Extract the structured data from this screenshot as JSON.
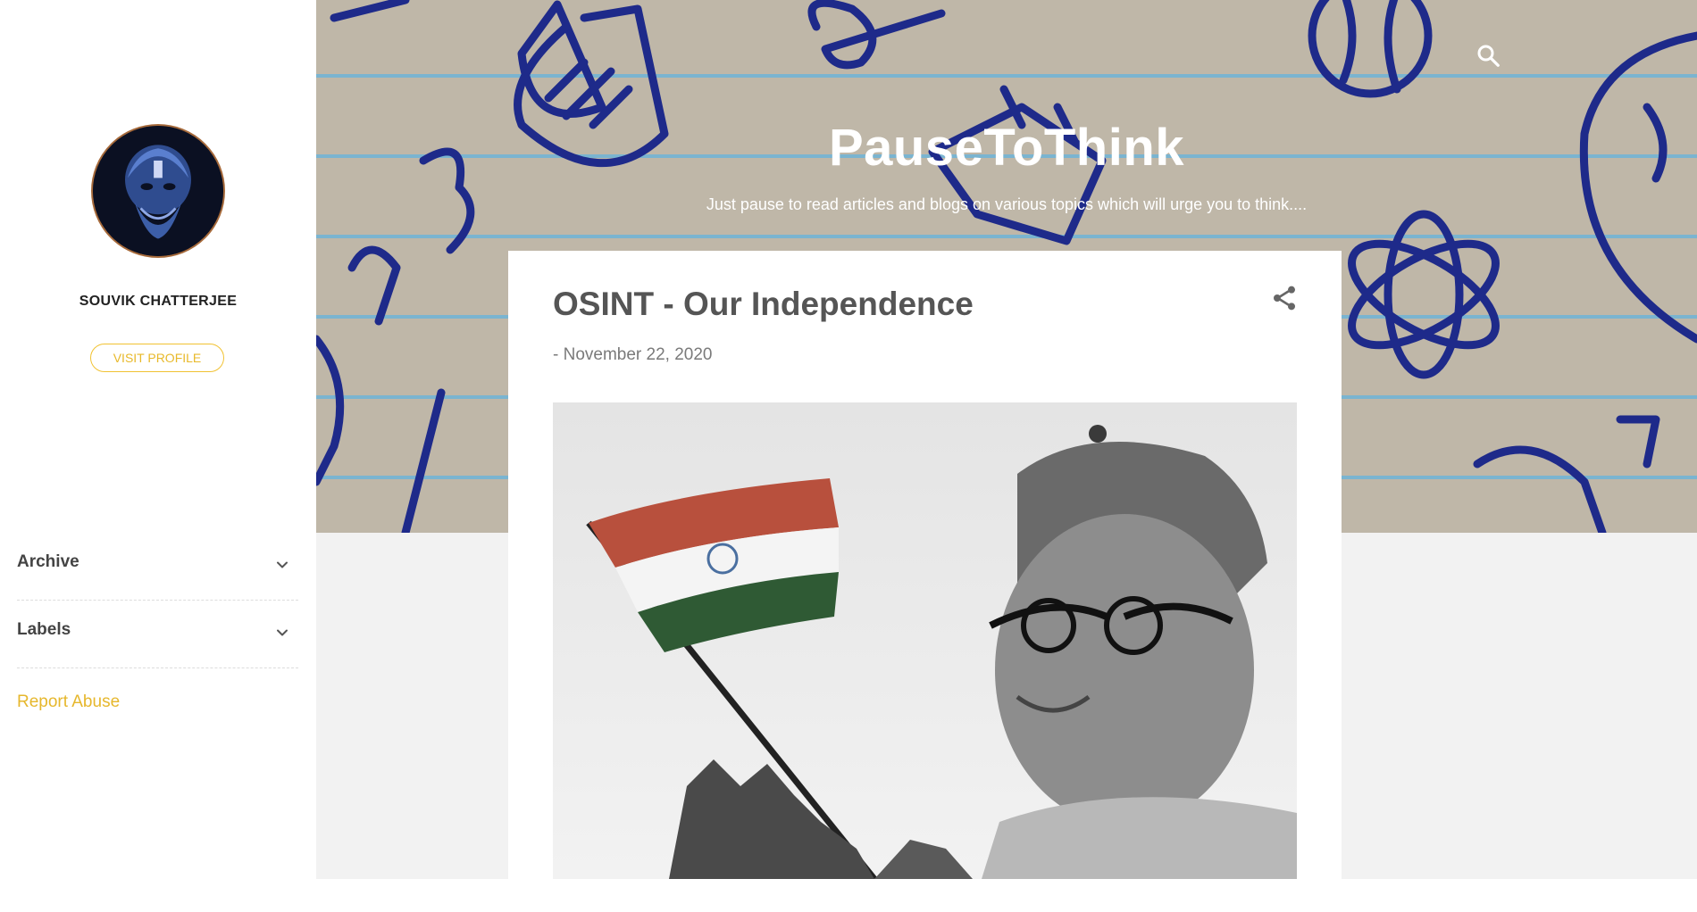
{
  "sidebar": {
    "avatar": {
      "icon": "avatar-icon"
    },
    "profile_name": "SOUVIK CHATTERJEE",
    "visit_profile_label": "VISIT PROFILE",
    "sections": [
      {
        "label": "Archive",
        "icon": "chevron-down-icon"
      },
      {
        "label": "Labels",
        "icon": "chevron-down-icon"
      }
    ],
    "report_abuse_label": "Report Abuse"
  },
  "header": {
    "title": "PauseToThink",
    "description": "Just pause to read articles and blogs on various topics which will urge you to think....",
    "search_icon": "search-icon"
  },
  "post": {
    "title": "OSINT - Our Independence",
    "date": "- November 22, 2020",
    "share_icon": "share-icon"
  },
  "colors": {
    "accent": "#f1c232",
    "header_bg": "#bfb7a8",
    "doodle": "#1e2a8a",
    "content_bg": "#f2f2f2"
  }
}
